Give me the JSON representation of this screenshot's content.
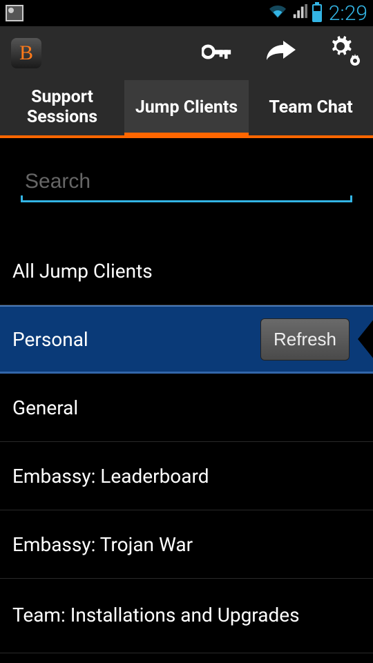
{
  "status": {
    "time": "2:29"
  },
  "app": {
    "icon_letter": "B"
  },
  "tabs": {
    "support_sessions": "Support Sessions",
    "jump_clients": "Jump Clients",
    "team_chat": "Team Chat"
  },
  "search": {
    "placeholder": "Search"
  },
  "list": {
    "all_jump_clients": "All Jump Clients",
    "personal": "Personal",
    "refresh_label": "Refresh",
    "general": "General",
    "embassy_leaderboard": "Embassy: Leaderboard",
    "embassy_trojan": "Embassy: Trojan War",
    "team_installations": "Team: Installations and Upgrades"
  },
  "colors": {
    "accent": "#33b5e5",
    "brand": "#ff6600",
    "selected_bg": "#0a3a78"
  }
}
